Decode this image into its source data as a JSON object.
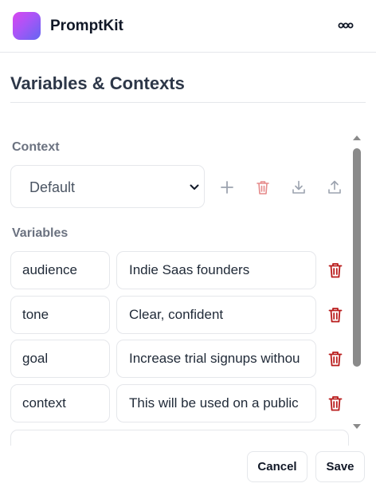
{
  "app": {
    "name": "PromptKit"
  },
  "header": {
    "menu_icon": "more-horizontal-icon"
  },
  "page": {
    "title": "Variables & Contexts"
  },
  "context": {
    "label": "Context",
    "selected": "Default",
    "tools": [
      {
        "icon": "plus-icon",
        "color": "#9ca3af"
      },
      {
        "icon": "trash-icon",
        "color": "#e58a8a"
      },
      {
        "icon": "download-icon",
        "color": "#9ca3af"
      },
      {
        "icon": "upload-icon",
        "color": "#9ca3af"
      }
    ]
  },
  "variables": {
    "label": "Variables",
    "items": [
      {
        "name": "audience",
        "value": "Indie Saas founders"
      },
      {
        "name": "tone",
        "value": "Clear, confident"
      },
      {
        "name": "goal",
        "value": "Increase trial signups withou"
      },
      {
        "name": "context",
        "value": "This will be used on a public"
      }
    ]
  },
  "actions": {
    "cancel": "Cancel",
    "save": "Save"
  },
  "colors": {
    "delete": "#b91c1c",
    "accent_from": "#d946ef",
    "accent_to": "#6366f1"
  }
}
